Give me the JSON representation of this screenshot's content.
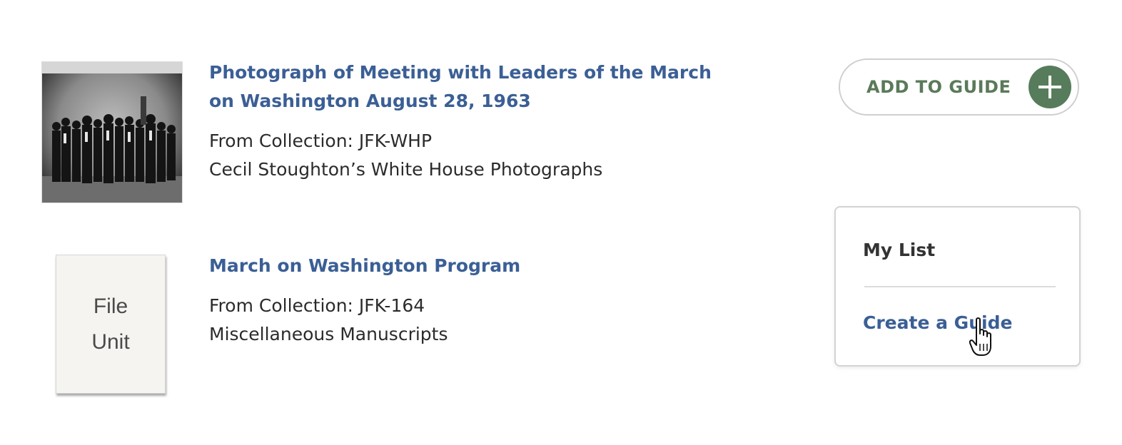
{
  "results": [
    {
      "title": "Photograph of Meeting with Leaders of the March on Washington August 28, 1963",
      "collection_line": "From Collection: JFK-WHP",
      "collection_name": "Cecil Stoughton’s White House Photographs"
    },
    {
      "thumbnail_text_line1": "File",
      "thumbnail_text_line2": "Unit",
      "title": "March on Washington Program",
      "collection_line": "From Collection: JFK-164",
      "collection_name": "Miscellaneous Manuscripts"
    }
  ],
  "add_to_guide": {
    "label": "ADD TO GUIDE",
    "icon": "plus-icon"
  },
  "dropdown": {
    "items": [
      {
        "label": "My List"
      },
      {
        "label": "Create a Guide"
      }
    ]
  },
  "colors": {
    "link": "#3b5f95",
    "button_accent": "#577c5b",
    "button_text": "#5a7a5a",
    "text": "#2b2b2b"
  }
}
